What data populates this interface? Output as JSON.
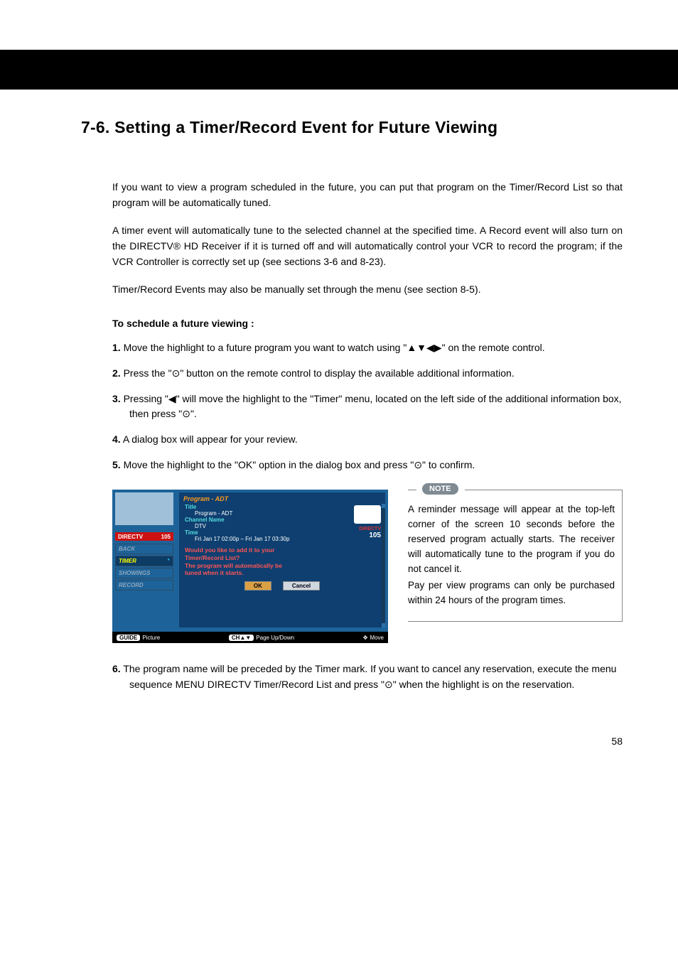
{
  "section": {
    "title": "7-6. Setting a Timer/Record Event for Future Viewing"
  },
  "intro": {
    "p1": "If you want to view a program scheduled in the future, you can put that program on the Timer/Record List so that program will be automatically tuned.",
    "p2": "A timer event will automatically tune to the selected channel at the specified time. A Record event will also turn on the DIRECTV® HD Receiver if it is turned off and will automatically control your VCR to record the program; if the VCR Controller is correctly set up (see sections 3-6 and 8-23).",
    "p3": "Timer/Record Events may also be manually set through the menu (see section 8-5)."
  },
  "procedure": {
    "heading": "To schedule a future viewing :",
    "steps": {
      "s1a": "Move the highlight to a future program you want to watch using \"",
      "s1_arrows": "▲▼◀▶",
      "s1b": "\" on the remote control.",
      "s2a": "Press the \"",
      "s2_dot": "⊙",
      "s2b": "\" button on the remote control to display the available additional information.",
      "s3a": "Pressing \"",
      "s3_left": "◀",
      "s3b": "\" will move the highlight to the \"Timer\" menu, located on the left side of the additional information box, then press \"",
      "s3_dot": "⊙",
      "s3c": "\".",
      "s4": "A dialog box will appear for your review.",
      "s5a": "Move the highlight to the \"OK\" option in the dialog box and press \"",
      "s5_dot": "⊙",
      "s5b": "\" to confirm.",
      "s6a": "The program name will be preceded by the Timer mark. If you want to cancel any reservation, execute the menu sequence MENU      DIRECTV      Timer/Record List and press \"",
      "s6_dot": "⊙",
      "s6b": "\" when the highlight is on the reservation."
    }
  },
  "note": {
    "label": "NOTE",
    "p1": "A reminder message will appear at the top-left corner of the screen 10 seconds before the reserved program actually starts. The receiver will automatically tune to the program if you do not cancel it.",
    "p2": "Pay per view programs can only be purchased within 24 hours of the program times."
  },
  "figure": {
    "program_title": "Program - ADT",
    "title_lbl": "Title",
    "title_val": "Program - ADT",
    "chan_lbl": "Channel Name",
    "chan_val": "DTV",
    "time_lbl": "Time",
    "time_val": "Fri Jan 17 02:00p – Fri Jan 17 03:30p",
    "dialog_l1": "Would you like to add it to your",
    "dialog_l2": "Timer/Record List?",
    "dialog_l3": "The program will automatically be",
    "dialog_l4": "tuned when it starts.",
    "ok": "OK",
    "cancel": "Cancel",
    "side_back": "BACK",
    "side_timer": "TIMER",
    "side_show": "SHOWINGS",
    "side_rec": "RECORD",
    "ch_label": "DIRECTV",
    "ch_num_left": "105",
    "ch_provider": "DIRECTV",
    "ch_right": "105",
    "foot_left": "Picture",
    "foot_left_pill": "GUIDE",
    "foot_center": "Page Up/Down",
    "foot_center_pill": "CH▲▼",
    "foot_right": "Move",
    "foot_right_icon": "✥"
  },
  "page_number": "58"
}
